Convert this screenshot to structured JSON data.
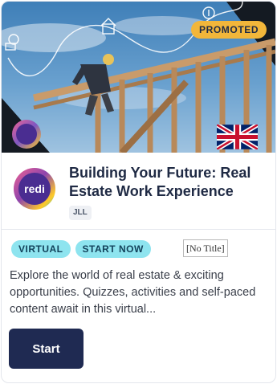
{
  "hero": {
    "badge": "PROMOTED",
    "brand_icon": "redi-logo-icon",
    "flag_icon": "uk-flag-icon"
  },
  "header": {
    "title": "Building Your Future: Real Estate Work Experience",
    "organisation": "JLL",
    "logo_text": "redi"
  },
  "tags": [
    "VIRTUAL",
    "START NOW"
  ],
  "no_title_label": "[No Title]",
  "description": "Explore the world of real estate & exciting opportunities. Quizzes, activities and self-paced content await in this virtual...",
  "cta": {
    "label": "Start"
  },
  "colors": {
    "badge": "#f2b63a",
    "tag": "#8ee4ef",
    "button": "#1f2a52",
    "title": "#1f2a44"
  }
}
